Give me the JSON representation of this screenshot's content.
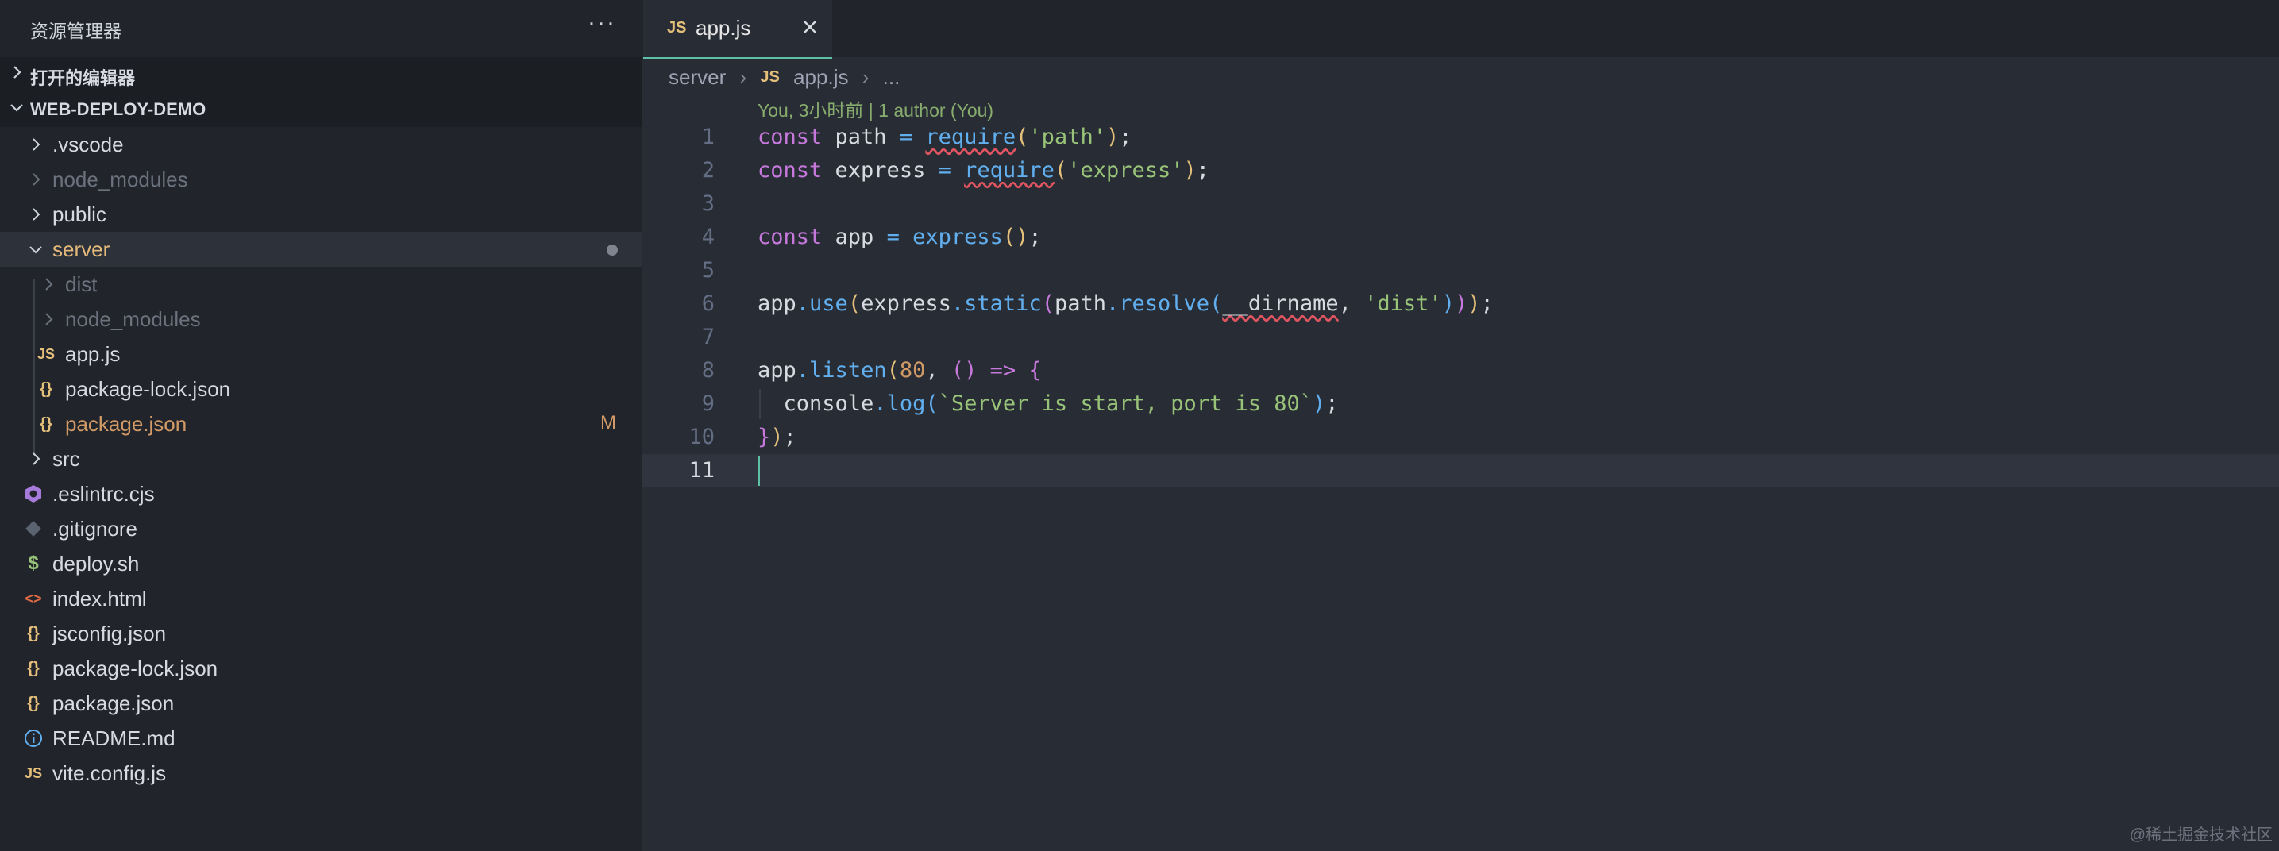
{
  "sidebar": {
    "title": "资源管理器",
    "more_label": "···",
    "open_editors_label": "打开的编辑器",
    "project_label": "WEB-DEPLOY-DEMO",
    "items": [
      {
        "label": ".vscode",
        "icon": "chevron-right-icon"
      },
      {
        "label": "node_modules",
        "icon": "chevron-right-icon",
        "dim": true
      },
      {
        "label": "public",
        "icon": "chevron-right-icon"
      },
      {
        "label": "server",
        "icon": "chevron-down-icon",
        "expanded": true
      },
      {
        "label": "dist",
        "icon": "chevron-right-icon",
        "dim": true
      },
      {
        "label": "node_modules",
        "icon": "chevron-right-icon",
        "dim": true
      },
      {
        "label": "app.js",
        "icon": "js-file-icon"
      },
      {
        "label": "package-lock.json",
        "icon": "json-file-icon"
      },
      {
        "label": "package.json",
        "icon": "json-file-icon",
        "status": "M"
      },
      {
        "label": "src",
        "icon": "chevron-right-icon"
      },
      {
        "label": ".eslintrc.cjs",
        "icon": "eslint-file-icon"
      },
      {
        "label": ".gitignore",
        "icon": "git-file-icon"
      },
      {
        "label": "deploy.sh",
        "icon": "shell-file-icon"
      },
      {
        "label": "index.html",
        "icon": "html-file-icon"
      },
      {
        "label": "jsconfig.json",
        "icon": "json-file-icon"
      },
      {
        "label": "package-lock.json",
        "icon": "json-file-icon"
      },
      {
        "label": "package.json",
        "icon": "json-file-icon"
      },
      {
        "label": "README.md",
        "icon": "info-file-icon"
      },
      {
        "label": "vite.config.js",
        "icon": "js-file-icon"
      }
    ]
  },
  "editor": {
    "tab": {
      "icon_text": "JS",
      "label": "app.js"
    },
    "breadcrumb": {
      "folder": "server",
      "file": "app.js",
      "rest": "..."
    },
    "blame": "You, 3小时前 | 1 author (You)",
    "line_numbers": [
      "1",
      "2",
      "3",
      "4",
      "5",
      "6",
      "7",
      "8",
      "9",
      "10",
      "11"
    ]
  },
  "watermark": "@稀土掘金技术社区",
  "colors": {
    "accent": "#5bc0a6",
    "modified": "#d19a66",
    "keyword": "#c678dd",
    "function": "#61afef",
    "string": "#98c379",
    "number": "#d19a66"
  }
}
